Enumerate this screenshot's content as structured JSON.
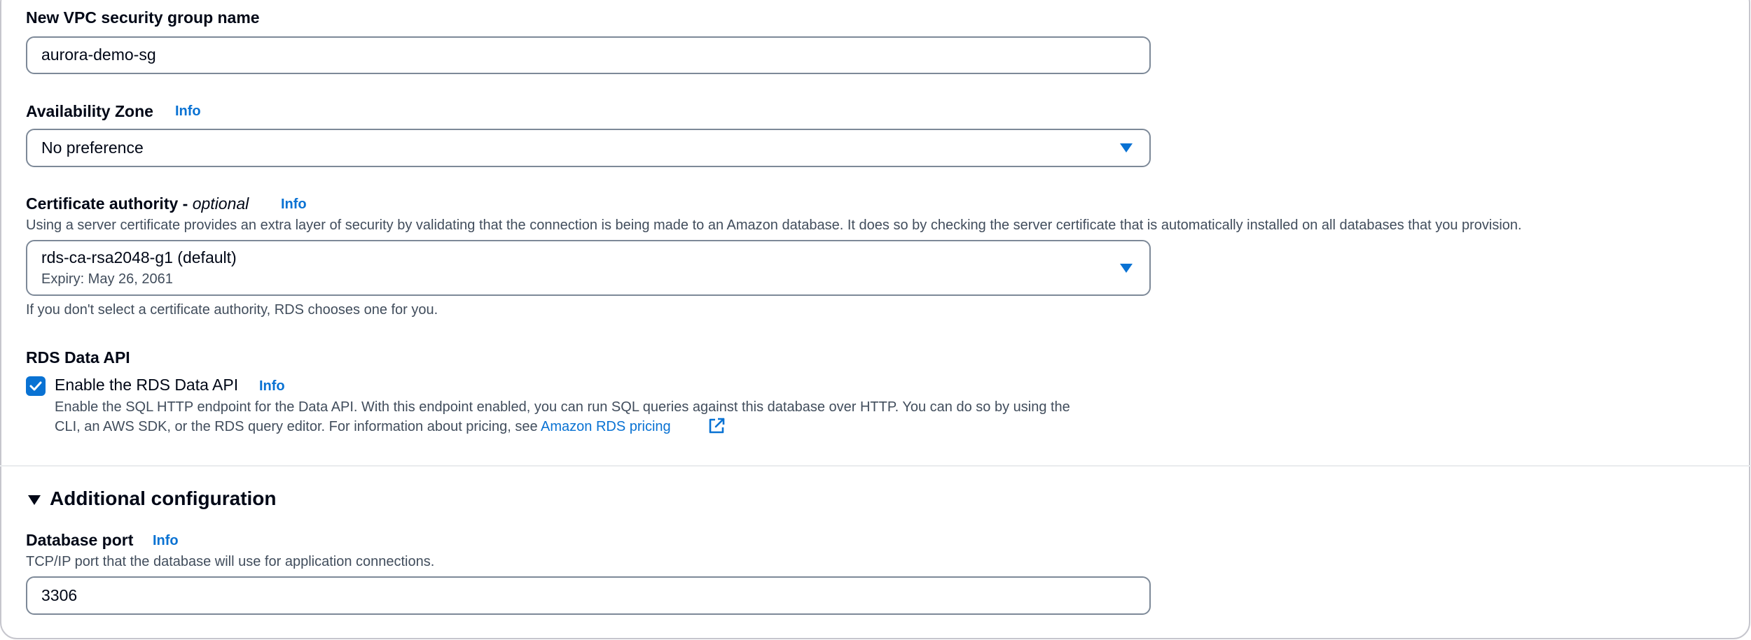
{
  "vpc_sg": {
    "label": "New VPC security group name",
    "value": "aurora-demo-sg"
  },
  "availability_zone": {
    "label": "Availability Zone",
    "info": "Info",
    "selected": "No preference"
  },
  "certificate": {
    "label": "Certificate authority - ",
    "label_optional": "optional",
    "info": "Info",
    "description": "Using a server certificate provides an extra layer of security by validating that the connection is being made to an Amazon database. It does so by checking the server certificate that is automatically installed on all databases that you provision.",
    "selected": "rds-ca-rsa2048-g1 (default)",
    "expiry": "Expiry: May 26, 2061",
    "hint": "If you don't select a certificate authority, RDS chooses one for you."
  },
  "data_api": {
    "heading": "RDS Data API",
    "checkbox_label": "Enable the RDS Data API",
    "checked": true,
    "info": "Info",
    "description_line1": "Enable the SQL HTTP endpoint for the Data API. With this endpoint enabled, you can run SQL queries against this database over HTTP. You can do so by using the",
    "description_line2": "CLI, an AWS SDK, or the RDS query editor. For information about pricing, see ",
    "pricing_link": "Amazon RDS pricing"
  },
  "additional_config": {
    "title": "Additional configuration",
    "expanded": true
  },
  "database_port": {
    "label": "Database port",
    "info": "Info",
    "description": "TCP/IP port that the database will use for application connections.",
    "value": "3306"
  },
  "colors": {
    "accent": "#0972d3",
    "text": "#000716",
    "secondary_text": "#414d5c",
    "border": "#7d8998"
  }
}
